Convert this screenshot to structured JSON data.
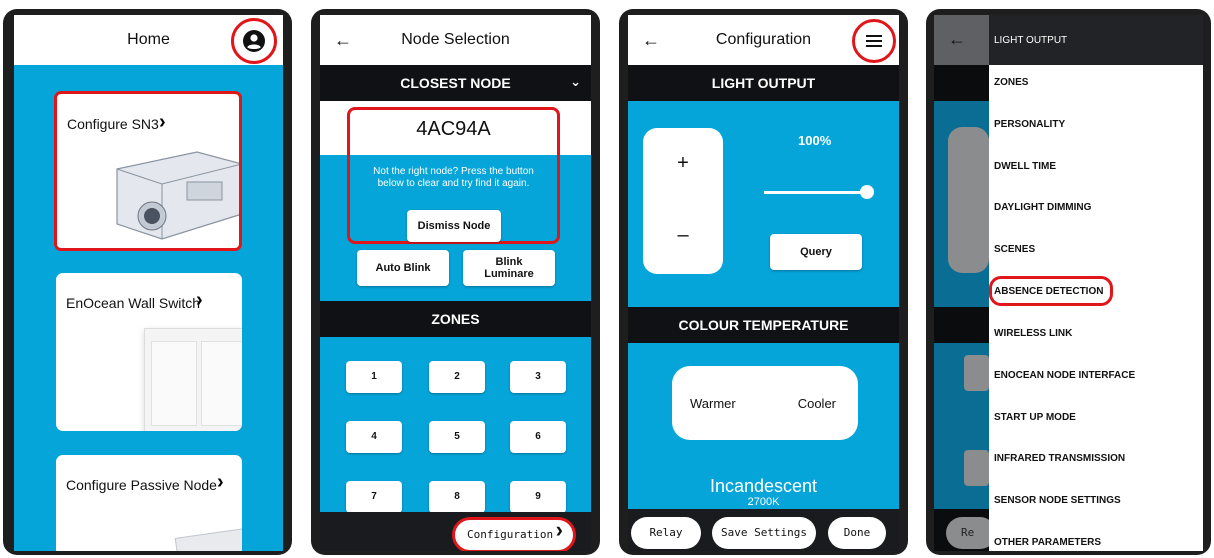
{
  "screen1": {
    "title": "Home",
    "cards": [
      {
        "label": "Configure SN3"
      },
      {
        "label": "EnOcean Wall Switch"
      },
      {
        "label": "Configure Passive Node"
      }
    ]
  },
  "screen2": {
    "back": "←",
    "title": "Node Selection",
    "closest_header": "CLOSEST NODE",
    "node_id": "4AC94A",
    "hint": "Not the right node? Press the button below to clear and try find it again.",
    "dismiss": "Dismiss Node",
    "auto_blink": "Auto Blink",
    "blink_luminaire": "Blink Luminare",
    "zones_header": "ZONES",
    "zones": [
      "1",
      "2",
      "3",
      "4",
      "5",
      "6",
      "7",
      "8",
      "9"
    ],
    "configuration": "Configuration"
  },
  "screen3": {
    "back": "←",
    "title": "Configuration",
    "light_output_header": "LIGHT OUTPUT",
    "plus": "+",
    "minus": "–",
    "percent": "100%",
    "slider_value": 1.0,
    "query": "Query",
    "colour_header": "COLOUR TEMPERATURE",
    "warmer": "Warmer",
    "cooler": "Cooler",
    "incandescent": "Incandescent",
    "kelvin": "2700K",
    "relay": "Relay",
    "save": "Save Settings",
    "done": "Done"
  },
  "screen4": {
    "back": "←",
    "relay_fragment": "Re",
    "menu": [
      "LIGHT OUTPUT",
      "ZONES",
      "PERSONALITY",
      "DWELL TIME",
      "DAYLIGHT DIMMING",
      "SCENES",
      "ABSENCE DETECTION",
      "WIRELESS LINK",
      "ENOCEAN NODE INTERFACE",
      "START UP MODE",
      "INFRARED TRANSMISSION",
      "SENSOR NODE SETTINGS",
      "OTHER PARAMETERS"
    ]
  },
  "colors": {
    "accent": "#06a5d9",
    "dark": "#0f1115",
    "highlight": "#e0161b"
  }
}
